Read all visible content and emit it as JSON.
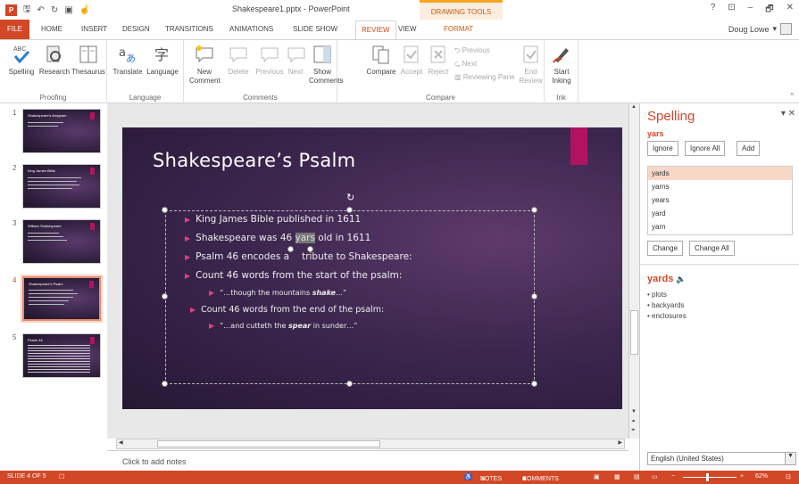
{
  "window": {
    "title": "Shakespeare1.pptx - PowerPoint",
    "contextual": "DRAWING TOOLS",
    "controls": [
      "?",
      "⊡",
      "–",
      "🗗",
      "✕"
    ]
  },
  "user": "Doug Lowe",
  "tabs": [
    "FILE",
    "HOME",
    "INSERT",
    "DESIGN",
    "TRANSITIONS",
    "ANIMATIONS",
    "SLIDE SHOW",
    "REVIEW",
    "VIEW",
    "FORMAT"
  ],
  "ribbon": {
    "proofing": {
      "name": "Proofing",
      "spelling": "Spelling",
      "research": "Research",
      "thesaurus": "Thesaurus"
    },
    "language": {
      "name": "Language",
      "translate": "Translate",
      "language": "Language"
    },
    "comments": {
      "name": "Comments",
      "new": "New Comment",
      "delete": "Delete",
      "previous": "Previous",
      "next": "Next",
      "show": "Show Comments"
    },
    "compare": {
      "name": "Compare",
      "compare": "Compare",
      "accept": "Accept",
      "reject": "Reject",
      "previous": "Previous",
      "next": "Next",
      "reviewing_pane": "Reviewing Pane",
      "end_review": "End Review"
    },
    "ink": {
      "name": "Ink",
      "start": "Start Inking"
    }
  },
  "thumbs": [
    {
      "n": "1",
      "t": "Shakespeare's Anagram"
    },
    {
      "n": "2",
      "t": "King James Bible"
    },
    {
      "n": "3",
      "t": "William Shakespeare"
    },
    {
      "n": "4",
      "t": "Shakespeare's Psalm"
    },
    {
      "n": "5",
      "t": "Psalm 46"
    }
  ],
  "slide": {
    "title": "Shakespeare’s Psalm",
    "b1": "King James Bible published in 1611",
    "b2a": "Shakespeare was 46 ",
    "b2w": "yars",
    "b2b": " old in 1611",
    "b3a": "Psalm 46 encodes a",
    "b3b": "tribute to Shakespeare:",
    "b4": "Count 46 words from  the start of the psalm:",
    "b5a": "“…though the mountains ",
    "b5b": "shake",
    "b5c": "…”",
    "b6": "Count 46 words from the end of the psalm:",
    "b7a": "“…and cutteth the ",
    "b7b": "spear",
    "b7c": " in sunder…”"
  },
  "notes": "Click to add notes",
  "spelling": {
    "title": "Spelling",
    "word": "yars",
    "ignore": "Ignore",
    "ignore_all": "Ignore All",
    "add": "Add",
    "suggestions": [
      "yards",
      "yarns",
      "years",
      "yard",
      "yarn"
    ],
    "change": "Change",
    "change_all": "Change All",
    "def_word": "yards",
    "def": [
      "• plots",
      "• backyards",
      "• enclosures"
    ],
    "language": "English (United States)"
  },
  "status": {
    "slide": "SLIDE 4 OF 5",
    "notes": "NOTES",
    "comments": "COMMENTS",
    "zoom": "62%"
  }
}
